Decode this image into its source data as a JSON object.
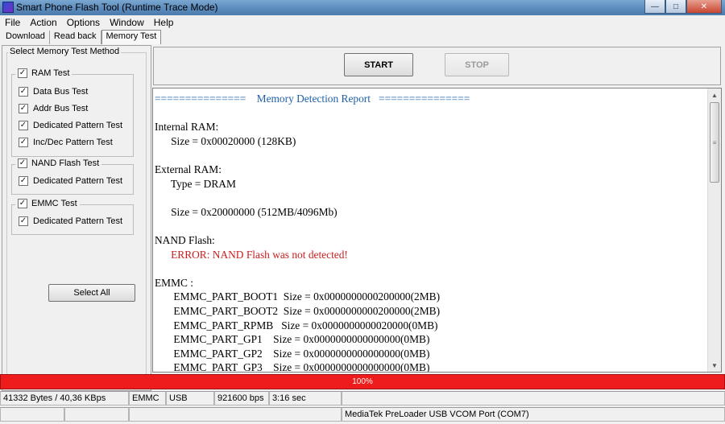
{
  "window": {
    "title": "Smart Phone Flash Tool (Runtime Trace Mode)"
  },
  "menu": [
    "File",
    "Action",
    "Options",
    "Window",
    "Help"
  ],
  "tabs": [
    {
      "label": "Download",
      "active": false
    },
    {
      "label": "Read back",
      "active": false
    },
    {
      "label": "Memory Test",
      "active": true
    }
  ],
  "method_panel": {
    "title": "Select Memory Test Method",
    "ram": {
      "label": "RAM Test",
      "checked": true,
      "items": [
        "Data Bus Test",
        "Addr Bus Test",
        "Dedicated Pattern Test",
        "Inc/Dec Pattern Test"
      ]
    },
    "nand": {
      "label": "NAND Flash Test",
      "checked": true,
      "items": [
        "Dedicated Pattern Test"
      ]
    },
    "emmc": {
      "label": "EMMC Test",
      "checked": true,
      "items": [
        "Dedicated Pattern Test"
      ]
    },
    "select_all": "Select All"
  },
  "controls": {
    "start": "START",
    "stop": "STOP"
  },
  "report": {
    "lines": [
      {
        "text": "===============    Memory Detection Report   ===============",
        "style": "blue"
      },
      {
        "text": "",
        "style": ""
      },
      {
        "text": "Internal RAM:",
        "style": ""
      },
      {
        "text": "      Size = 0x00020000 (128KB)",
        "style": ""
      },
      {
        "text": "",
        "style": ""
      },
      {
        "text": "External RAM:",
        "style": ""
      },
      {
        "text": "      Type = DRAM",
        "style": ""
      },
      {
        "text": "",
        "style": ""
      },
      {
        "text": "      Size = 0x20000000 (512MB/4096Mb)",
        "style": ""
      },
      {
        "text": "",
        "style": ""
      },
      {
        "text": "NAND Flash:",
        "style": ""
      },
      {
        "text": "      ERROR: NAND Flash was not detected!",
        "style": "red"
      },
      {
        "text": "",
        "style": ""
      },
      {
        "text": "EMMC :",
        "style": ""
      },
      {
        "text": "       EMMC_PART_BOOT1  Size = 0x0000000000200000(2MB)",
        "style": ""
      },
      {
        "text": "       EMMC_PART_BOOT2  Size = 0x0000000000200000(2MB)",
        "style": ""
      },
      {
        "text": "       EMMC_PART_RPMB   Size = 0x0000000000020000(0MB)",
        "style": ""
      },
      {
        "text": "       EMMC_PART_GP1    Size = 0x0000000000000000(0MB)",
        "style": ""
      },
      {
        "text": "       EMMC_PART_GP2    Size = 0x0000000000000000(0MB)",
        "style": ""
      },
      {
        "text": "       EMMC_PART_GP3    Size = 0x0000000000000000(0MB)",
        "style": ""
      }
    ]
  },
  "progress": {
    "value": 1.0,
    "label": "100%",
    "color": "#e21e1e"
  },
  "status": {
    "bytes": "41332 Bytes / 40,36 KBps",
    "storage": "EMMC",
    "conn": "USB",
    "baud": "921600 bps",
    "time": "3:16 sec",
    "port": "MediaTek PreLoader USB VCOM Port (COM7)"
  }
}
